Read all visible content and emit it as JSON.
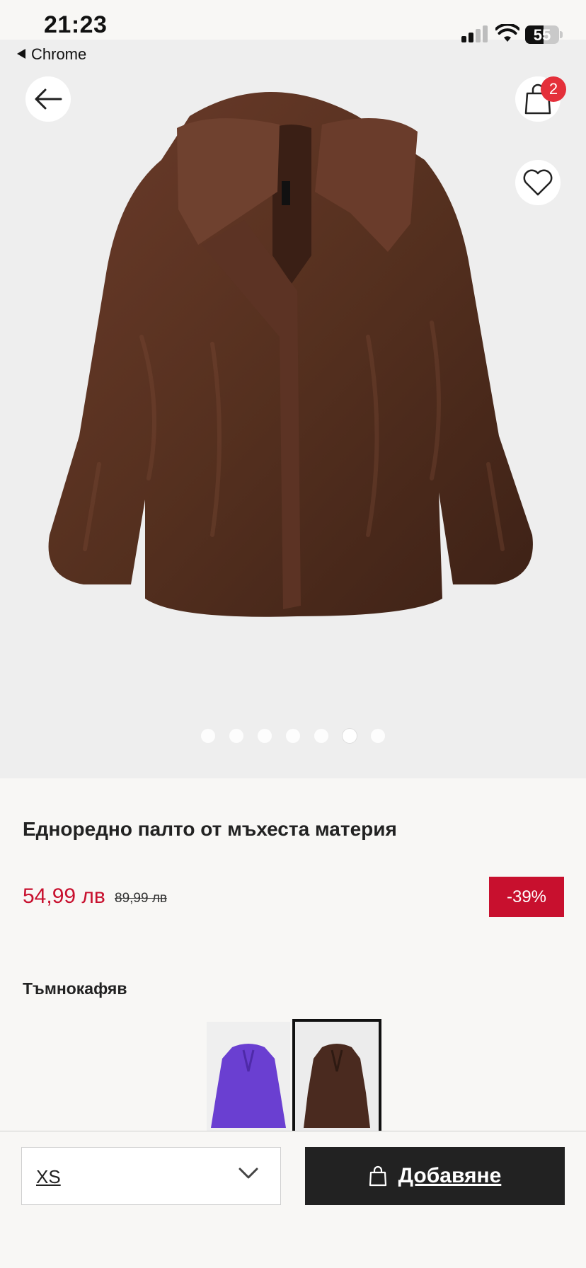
{
  "status_bar": {
    "time": "21:23",
    "battery": "55"
  },
  "browser_back": {
    "label": "Chrome"
  },
  "header": {
    "cart_count": "2"
  },
  "gallery": {
    "dots": 7,
    "active_index": 5
  },
  "product": {
    "title": "Едноредно палто от мъхеста материя",
    "price": "54,99 лв",
    "old_price": "89,99 лв",
    "discount": "-39%",
    "color_name": "Тъмнокафяв"
  },
  "swatches": [
    {
      "name": "purple",
      "color": "#6a3fd1",
      "selected": false
    },
    {
      "name": "dark-brown",
      "color": "#4a2a1f",
      "selected": true
    }
  ],
  "bottom_bar": {
    "size_value": "XS",
    "add_label": "Добавяне"
  },
  "colors": {
    "accent_red": "#c8102e",
    "badge_red": "#e42f3a",
    "dark": "#222222",
    "coat_brown": "#5a3325"
  }
}
